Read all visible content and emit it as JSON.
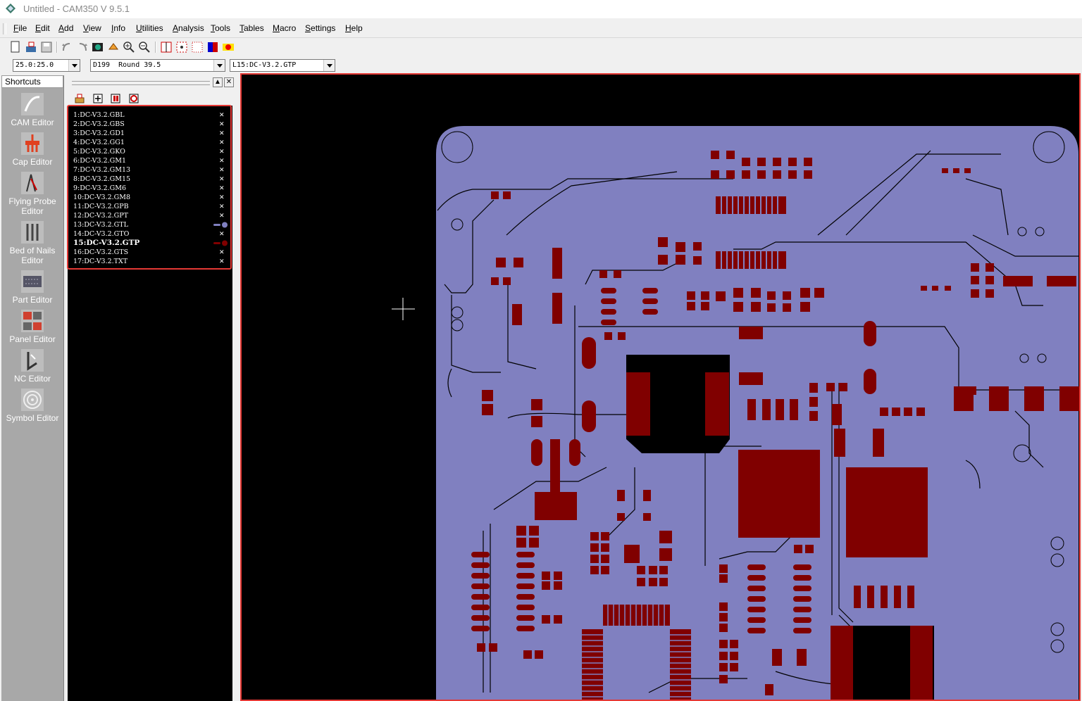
{
  "window": {
    "title": "Untitled - CAM350 V 9.5.1"
  },
  "menu": {
    "items": [
      {
        "ul": "F",
        "rest": "ile"
      },
      {
        "ul": "E",
        "rest": "dit"
      },
      {
        "ul": "A",
        "rest": "dd"
      },
      {
        "ul": "V",
        "rest": "iew"
      },
      {
        "ul": "I",
        "rest": "nfo"
      },
      {
        "ul": "U",
        "rest": "tilities"
      },
      {
        "ul": "A",
        "rest": "nalysis"
      },
      {
        "ul": "T",
        "rest": "ools"
      },
      {
        "ul": "T",
        "rest": "ables"
      },
      {
        "ul": "M",
        "rest": "acro"
      },
      {
        "ul": "S",
        "rest": "ettings"
      },
      {
        "ul": "H",
        "rest": "elp"
      }
    ]
  },
  "toolbar": {
    "icons": [
      "new-file-icon",
      "open-file-icon",
      "save-file-icon",
      "undo-icon",
      "redo-icon",
      "refresh-view-icon",
      "pan-icon",
      "zoom-in-icon",
      "zoom-out-icon",
      "zoom-window-icon",
      "grid-icon",
      "snap-grid-icon",
      "colors-icon",
      "highlight-icon"
    ]
  },
  "combos": {
    "zoom": "25.0:25.0",
    "dcode": "D199  Round 39.5",
    "layer": "L15:DC-V3.2.GTP"
  },
  "shortcuts": {
    "header": "Shortcuts",
    "items": [
      {
        "label": "CAM Editor",
        "icon": "cam-editor-icon"
      },
      {
        "label": "Cap Editor",
        "icon": "cap-editor-icon"
      },
      {
        "label": "Flying Probe Editor",
        "icon": "flying-probe-editor-icon"
      },
      {
        "label": "Bed of Nails Editor",
        "icon": "bed-of-nails-editor-icon"
      },
      {
        "label": "Part Editor",
        "icon": "part-editor-icon"
      },
      {
        "label": "Panel Editor",
        "icon": "panel-editor-icon"
      },
      {
        "label": "NC Editor",
        "icon": "nc-editor-icon"
      },
      {
        "label": "Symbol Editor",
        "icon": "symbol-editor-icon"
      }
    ]
  },
  "layers": [
    {
      "label": "1:DC-V3.2.GBL",
      "state": "off"
    },
    {
      "label": "2:DC-V3.2.GBS",
      "state": "off"
    },
    {
      "label": "3:DC-V3.2.GD1",
      "state": "off"
    },
    {
      "label": "4:DC-V3.2.GG1",
      "state": "off"
    },
    {
      "label": "5:DC-V3.2.GKO",
      "state": "off"
    },
    {
      "label": "6:DC-V3.2.GM1",
      "state": "off"
    },
    {
      "label": "7:DC-V3.2.GM13",
      "state": "off"
    },
    {
      "label": "8:DC-V3.2.GM15",
      "state": "off"
    },
    {
      "label": "9:DC-V3.2.GM6",
      "state": "off"
    },
    {
      "label": "10:DC-V3.2.GM8",
      "state": "off"
    },
    {
      "label": "11:DC-V3.2.GPB",
      "state": "off"
    },
    {
      "label": "12:DC-V3.2.GPT",
      "state": "off"
    },
    {
      "label": "13:DC-V3.2.GTL",
      "state": "on",
      "color": "#8080c0"
    },
    {
      "label": "14:DC-V3.2.GTO",
      "state": "off"
    },
    {
      "label": "15:DC-V3.2.GTP",
      "state": "active",
      "color": "#800000"
    },
    {
      "label": "16:DC-V3.2.GTS",
      "state": "off"
    },
    {
      "label": "17:DC-V3.2.TXT",
      "state": "off"
    }
  ],
  "colors": {
    "board": "#8080c0",
    "pads": "#800000",
    "canvas_bg": "#000000",
    "highlight": "#e53935"
  }
}
